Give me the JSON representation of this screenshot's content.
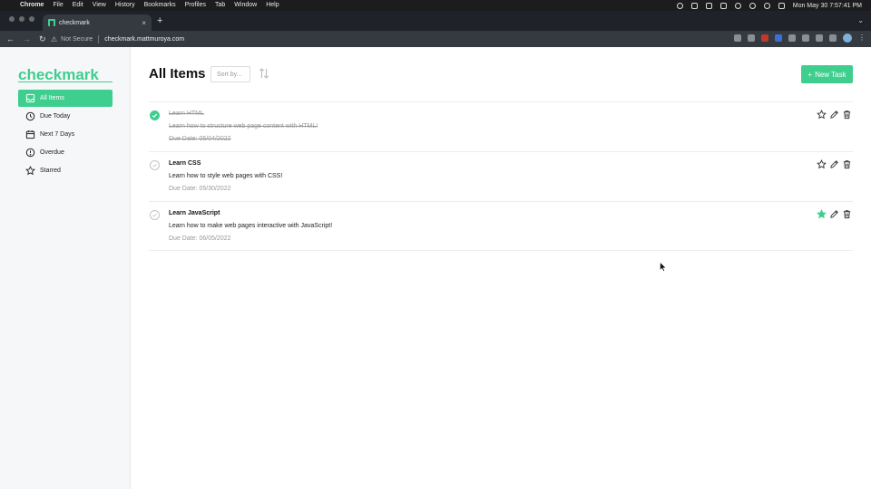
{
  "os_menubar": {
    "apple": "",
    "app": "Chrome",
    "menus": [
      "File",
      "Edit",
      "View",
      "History",
      "Bookmarks",
      "Profiles",
      "Tab",
      "Window",
      "Help"
    ],
    "datetime": "Mon May 30  7:57:41 PM"
  },
  "browser": {
    "tab_title": "checkmark",
    "tab_close": "×",
    "new_tab": "+",
    "tab_overflow": "⌄",
    "security_label": "Not Secure",
    "url": "checkmark.mattmuroya.com",
    "back": "←",
    "forward": "→",
    "reload": "↻",
    "menu_dots": "⋮"
  },
  "sidebar": {
    "brand": "checkmark",
    "items": [
      {
        "label": "All Items",
        "icon": "inbox-icon",
        "active": true
      },
      {
        "label": "Due Today",
        "icon": "clock-icon",
        "active": false
      },
      {
        "label": "Next 7 Days",
        "icon": "calendar-icon",
        "active": false
      },
      {
        "label": "Overdue",
        "icon": "alert-circle-icon",
        "active": false
      },
      {
        "label": "Starred",
        "icon": "star-icon",
        "active": false
      }
    ]
  },
  "main": {
    "title": "All Items",
    "sort_placeholder": "Sort by...",
    "new_task_label": "New Task",
    "new_task_plus": "+"
  },
  "tasks": [
    {
      "title": "Learn HTML",
      "description": "Learn how to structure web page content with HTML!",
      "due": "Due Date: 05/04/2022",
      "completed": true,
      "starred": false
    },
    {
      "title": "Learn CSS",
      "description": "Learn how to style web pages with CSS!",
      "due": "Due Date: 05/30/2022",
      "completed": false,
      "starred": false
    },
    {
      "title": "Learn JavaScript",
      "description": "Learn how to make web pages interactive with JavaScript!",
      "due": "Due Date: 06/05/2022",
      "completed": false,
      "starred": true
    }
  ],
  "colors": {
    "accent": "#3ecf8e",
    "muted": "#999999",
    "sidebar_bg": "#f6f7f9"
  }
}
